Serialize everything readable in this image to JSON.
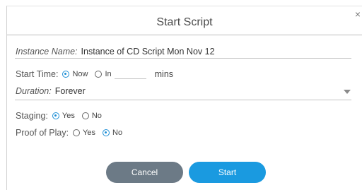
{
  "dialog": {
    "title": "Start Script",
    "close_glyph": "×"
  },
  "instance": {
    "label": "Instance Name:",
    "value": "Instance of CD Script Mon Nov 12"
  },
  "start_time": {
    "label": "Start Time:",
    "option_now": "Now",
    "option_in": "In",
    "selected": "Now",
    "minutes_value": "",
    "unit": "mins"
  },
  "duration": {
    "label": "Duration:",
    "value": "Forever"
  },
  "staging": {
    "label": "Staging:",
    "option_yes": "Yes",
    "option_no": "No",
    "selected": "Yes"
  },
  "proof_of_play": {
    "label": "Proof of Play:",
    "option_yes": "Yes",
    "option_no": "No",
    "selected": "No"
  },
  "buttons": {
    "cancel": "Cancel",
    "start": "Start"
  },
  "colors": {
    "accent": "#1a9ae0",
    "cancel": "#6c7a86"
  }
}
